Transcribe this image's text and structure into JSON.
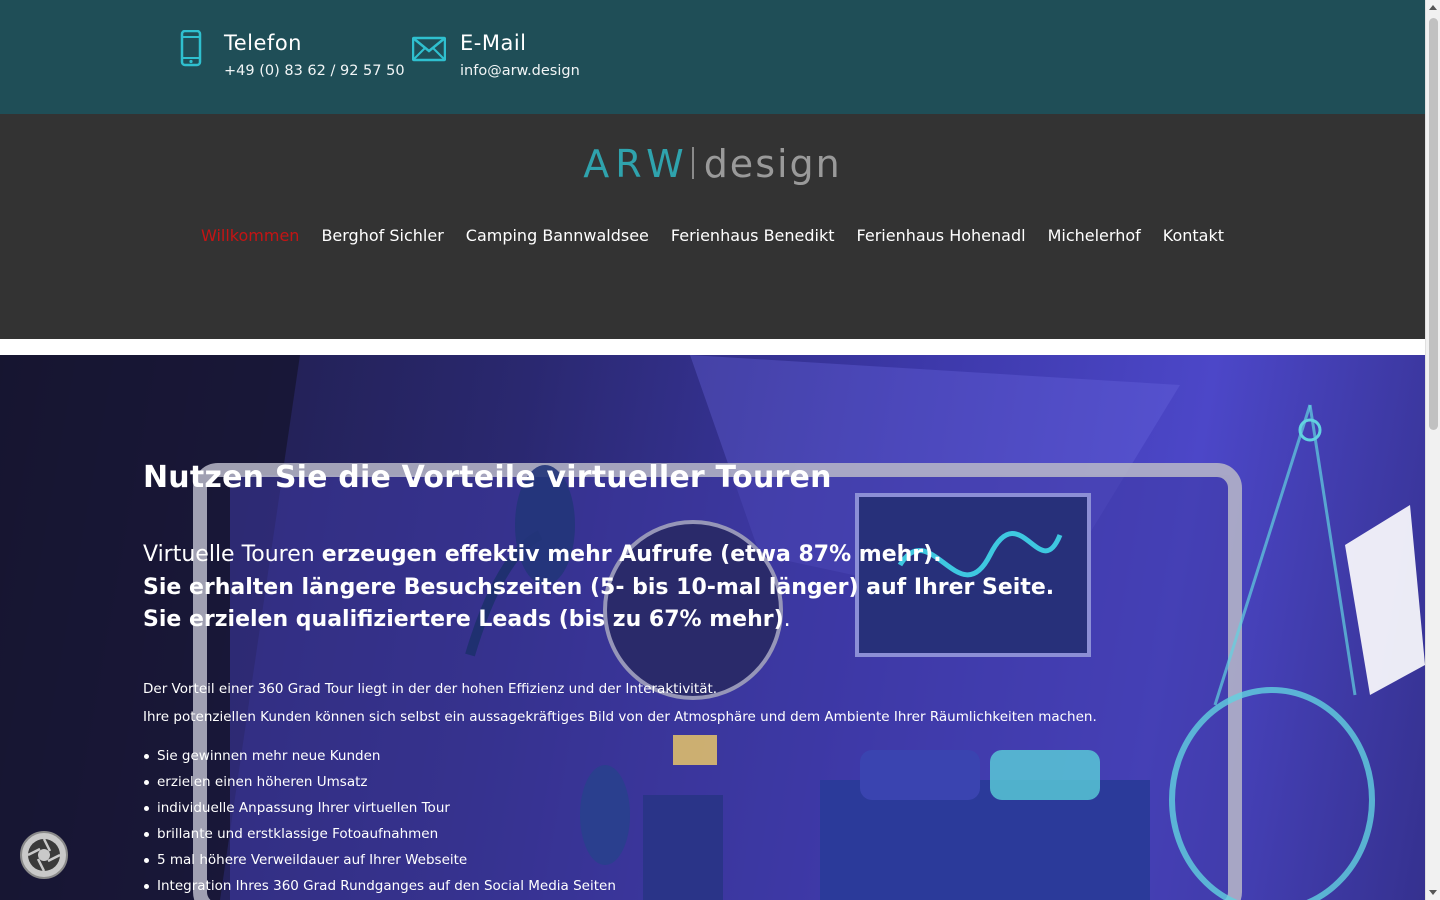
{
  "contact": {
    "phone": {
      "title": "Telefon",
      "value": "+49 (0) 83 62 / 92 57 50",
      "icon": "smartphone-icon"
    },
    "mail": {
      "title": "E-Mail",
      "value": "info@arw.design",
      "icon": "envelope-icon"
    }
  },
  "logo": {
    "brand": "ARW",
    "suffix": "design"
  },
  "nav": [
    {
      "label": "Willkommen",
      "active": true
    },
    {
      "label": "Berghof Sichler"
    },
    {
      "label": "Camping Bannwaldsee"
    },
    {
      "label": "Ferienhaus Benedikt"
    },
    {
      "label": "Ferienhaus Hohenadl"
    },
    {
      "label": "Michelerhof"
    },
    {
      "label": "Kontakt"
    }
  ],
  "hero": {
    "heading": "Nutzen Sie die Vorteile virtueller Touren",
    "lead": {
      "l1_normal": "Virtuelle Touren ",
      "l1_bold": "erzeugen effektiv mehr Aufrufe (etwa 87% mehr).",
      "l2_bold": "Sie erhalten längere Besuchszeiten (5- bis 10-mal länger) auf Ihrer Seite.",
      "l3_bold": "Sie erzielen qualifiziertere Leads (bis zu 67% mehr)",
      "l3_end": "."
    },
    "p1": "Der Vorteil einer 360 Grad Tour liegt in der der hohen Effizienz und der Interaktivität.",
    "p2": "Ihre potenziellen Kunden können sich selbst ein aussagekräftiges Bild von der Atmosphäre und dem Ambiente Ihrer Räumlichkeiten machen.",
    "bullets": [
      "Sie gewinnen mehr neue Kunden",
      "erzielen einen höheren Umsatz",
      "individuelle Anpassung Ihrer virtuellen Tour",
      "brillante und erstklassige Fotoaufnahmen",
      "5 mal höhere Verweildauer auf Ihrer Webseite",
      "Integration Ihres 360 Grad Rundganges auf den Social Media Seiten"
    ]
  },
  "colors": {
    "topbar": "#1f4e57",
    "header": "#333333",
    "accent": "#2fa3ad",
    "nav_active": "#c41414"
  }
}
